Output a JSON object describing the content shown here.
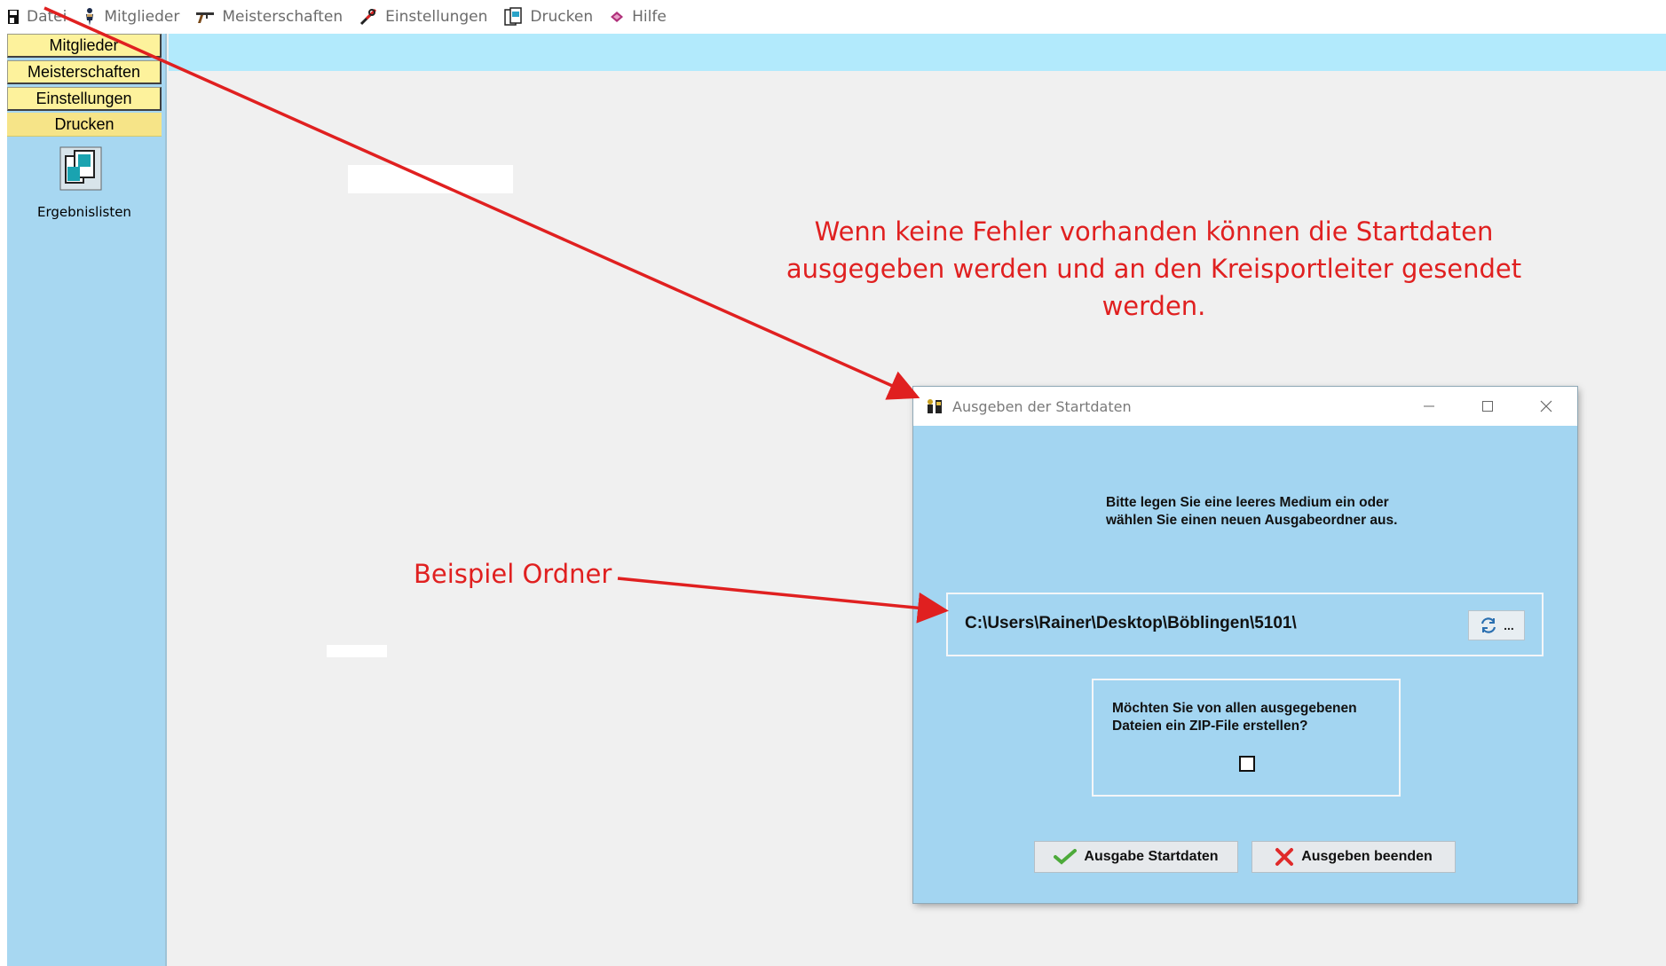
{
  "menubar": {
    "items": [
      {
        "label": "Datei",
        "icon": "disk-icon"
      },
      {
        "label": "Mitglieder",
        "icon": "person-icon"
      },
      {
        "label": "Meisterschaften",
        "icon": "rifle-icon"
      },
      {
        "label": "Einstellungen",
        "icon": "tools-icon"
      },
      {
        "label": "Drucken",
        "icon": "print-document-icon"
      },
      {
        "label": "Hilfe",
        "icon": "book-icon"
      }
    ]
  },
  "sidebar": {
    "buttons": [
      "Mitglieder",
      "Meisterschaften",
      "Einstellungen",
      "Drucken"
    ],
    "icon_label": "Ergebnislisten"
  },
  "annotations": {
    "top_note": "Wenn keine Fehler vorhanden können die Startdaten ausgegeben werden und an den Kreisportleiter gesendet werden.",
    "folder_note": "Beispiel Ordner",
    "color": "#e02020"
  },
  "dialog": {
    "title": "Ausgeben der Startdaten",
    "prompt": "Bitte legen Sie eine leeres Medium ein oder wählen Sie einen neuen Ausgabeordner aus.",
    "path": "C:\\Users\\Rainer\\Desktop\\Böblingen\\5101\\",
    "browse_label": "...",
    "zip_question": "Möchten Sie von allen ausgegebenen Dateien ein ZIP-File erstellen?",
    "zip_checked": false,
    "ok_label": "Ausgabe Startdaten",
    "cancel_label": "Ausgeben beenden"
  },
  "colors": {
    "sidebar_bg": "#a7d7f1",
    "sidebar_button": "#fdf29c",
    "top_strip": "#b2eafc",
    "main_bg": "#f0f0f0",
    "dialog_bg": "#a3d5f1"
  }
}
